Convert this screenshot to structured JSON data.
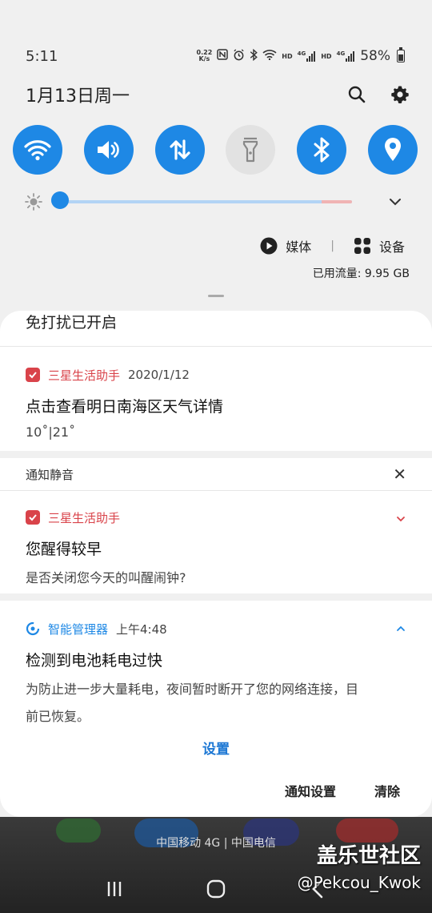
{
  "status": {
    "time": "5:11",
    "net_speed_value": "0.22",
    "net_speed_unit": "K/s",
    "hd1": "HD",
    "g1": "4G",
    "hd2": "HD",
    "g2": "4G",
    "battery": "58%"
  },
  "header": {
    "date": "1月13日周一"
  },
  "toggles": [
    {
      "name": "wifi",
      "on": true
    },
    {
      "name": "sound",
      "on": true
    },
    {
      "name": "mobile-data",
      "on": true
    },
    {
      "name": "flashlight",
      "on": false
    },
    {
      "name": "bluetooth",
      "on": true
    },
    {
      "name": "location",
      "on": true
    }
  ],
  "brightness": {
    "level": 0.0
  },
  "media_row": {
    "media_label": "媒体",
    "devices_label": "设备",
    "separator": "|",
    "usage": "已用流量: 9.95 GB"
  },
  "dnd": "免打扰已开启",
  "notif1": {
    "app": "三星生活助手",
    "time": "2020/1/12",
    "title": "点击查看明日南海区天气详情",
    "sub": "10˚|21˚"
  },
  "silent": {
    "label": "通知静音",
    "close": "✕"
  },
  "notif2": {
    "app": "三星生活助手",
    "title": "您醒得较早",
    "sub": "是否关闭您今天的叫醒闹钟?"
  },
  "notif3": {
    "app": "智能管理器",
    "time": "上午4:48",
    "title": "检测到电池耗电过快",
    "body_line1": "为防止进一步大量耗电，夜间暂时断开了您的网络连接，目",
    "body_line2": "前已恢复。",
    "action": "设置"
  },
  "footer": {
    "notif_settings": "通知设置",
    "clear": "清除"
  },
  "home": {
    "carrier": "中国移动 4G | 中国电信",
    "watermark": "盖乐世社区",
    "watermark2": "@Pekcou_Kwok"
  },
  "colors": {
    "accent": "#1e88e5",
    "app_red": "#d9434a",
    "link_blue": "#1e78d4"
  }
}
